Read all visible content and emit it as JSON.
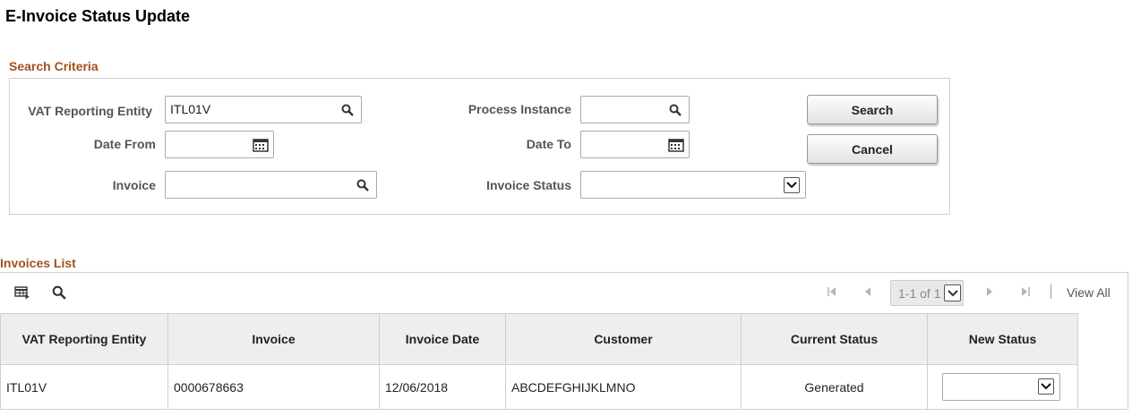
{
  "page": {
    "title": "E-Invoice Status Update"
  },
  "search": {
    "section_title": "Search Criteria",
    "vat_entity_label": "VAT Reporting Entity",
    "vat_entity_value": "ITL01V",
    "process_instance_label": "Process Instance",
    "process_instance_value": "",
    "date_from_label": "Date From",
    "date_from_value": "",
    "date_to_label": "Date To",
    "date_to_value": "",
    "invoice_label": "Invoice",
    "invoice_value": "",
    "invoice_status_label": "Invoice Status",
    "invoice_status_value": "",
    "search_button": "Search",
    "cancel_button": "Cancel"
  },
  "invoices": {
    "section_title": "Invoices List",
    "pager_text": "1-1 of 1",
    "view_all": "View All",
    "columns": [
      "VAT Reporting Entity",
      "Invoice",
      "Invoice Date",
      "Customer",
      "Current Status",
      "New Status"
    ],
    "rows": [
      {
        "vat_entity": "ITL01V",
        "invoice": "0000678663",
        "invoice_date": "12/06/2018",
        "customer": "ABCDEFGHIJKLMNO",
        "current_status": "Generated",
        "new_status": ""
      }
    ]
  },
  "colors": {
    "section_title": "#a0521d",
    "header_bg": "#eeeeee",
    "border": "#cfcfcf"
  },
  "icons": [
    "search-icon",
    "calendar-icon",
    "chevron-down-icon",
    "grid-personalize-icon",
    "first-page-icon",
    "previous-page-icon",
    "next-page-icon",
    "last-page-icon"
  ]
}
